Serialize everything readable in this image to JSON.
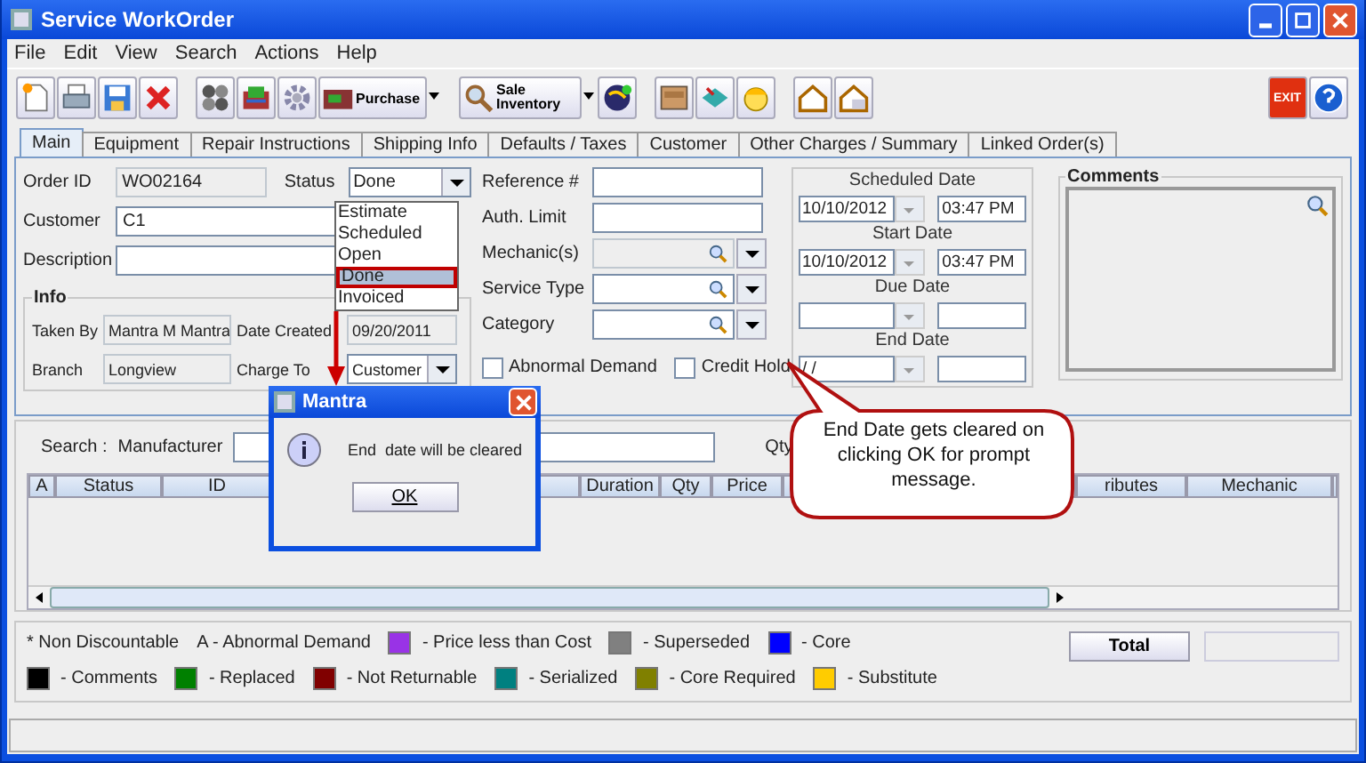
{
  "window": {
    "title": "Service WorkOrder"
  },
  "menu": [
    "File",
    "Edit",
    "View",
    "Search",
    "Actions",
    "Help"
  ],
  "toolbar": {
    "purchase_label": "Purchase",
    "sale_label": "Sale Inventory",
    "exit_label": "EXIT"
  },
  "tabs": [
    {
      "label": "Main",
      "selected": true
    },
    {
      "label": "Equipment",
      "selected": false
    },
    {
      "label": "Repair Instructions",
      "selected": false
    },
    {
      "label": "Shipping Info",
      "selected": false
    },
    {
      "label": "Defaults / Taxes",
      "selected": false
    },
    {
      "label": "Customer",
      "selected": false
    },
    {
      "label": "Other Charges / Summary",
      "selected": false
    },
    {
      "label": "Linked Order(s)",
      "selected": false
    }
  ],
  "order": {
    "order_id_label": "Order ID",
    "order_id": "WO02164",
    "status_label": "Status",
    "status": "Done",
    "customer_label": "Customer",
    "customer": "C1",
    "description_label": "Description"
  },
  "status_options": [
    {
      "label": "Estimate",
      "selected": false
    },
    {
      "label": "Scheduled",
      "selected": false
    },
    {
      "label": "Open",
      "selected": false
    },
    {
      "label": "Done",
      "selected": true
    },
    {
      "label": "Invoiced",
      "selected": false
    }
  ],
  "info": {
    "title": "Info",
    "taken_by_label": "Taken By",
    "taken_by": "Mantra M Mantra",
    "date_created_label": "Date Created",
    "date_created": "09/20/2011",
    "branch_label": "Branch",
    "branch": "Longview",
    "charge_to_label": "Charge To",
    "charge_to": "Customer"
  },
  "middle": {
    "reference_label": "Reference #",
    "auth_label": "Auth. Limit",
    "mechanic_label": "Mechanic(s)",
    "service_type_label": "Service Type",
    "category_label": "Category"
  },
  "checkboxes": [
    {
      "label": "Abnormal Demand",
      "checked": false
    },
    {
      "label": "Credit Hold",
      "checked": false
    }
  ],
  "dates": [
    {
      "label": "Scheduled Date",
      "date": "10/10/2012",
      "time": "03:47 PM"
    },
    {
      "label": "Start Date",
      "date": "10/10/2012",
      "time": "03:47 PM"
    },
    {
      "label": "Due Date"
    },
    {
      "label": "End Date",
      "date": "/ /"
    }
  ],
  "comments": {
    "title": "Comments"
  },
  "search": {
    "label": "Search :",
    "manufacturer_label": "Manufacturer",
    "qty_label": "Qty"
  },
  "table": {
    "columns": [
      "A",
      "Status",
      "ID",
      "Duration",
      "Qty",
      "Price",
      "ributes",
      "Mechanic"
    ]
  },
  "legend": {
    "notes": [
      "* Non Discountable",
      "A - Abnormal Demand"
    ],
    "items": [
      {
        "label": "- Price less than Cost",
        "color": "#9933e6"
      },
      {
        "label": "- Superseded",
        "color": "#808080"
      },
      {
        "label": "- Core",
        "color": "#0000ff"
      },
      {
        "label": "- Comments",
        "color": "#000000"
      },
      {
        "label": "- Replaced",
        "color": "#008000"
      },
      {
        "label": "- Not Returnable",
        "color": "#800000"
      },
      {
        "label": "- Serialized",
        "color": "#008080"
      },
      {
        "label": "- Core Required",
        "color": "#808000"
      },
      {
        "label": "- Substitute",
        "color": "#ffcc00"
      }
    ]
  },
  "total_button": "Total",
  "dialog": {
    "title": "Mantra",
    "message": "End  date will be cleared",
    "ok": "OK"
  },
  "callout": "End Date gets cleared on clicking OK for prompt message."
}
